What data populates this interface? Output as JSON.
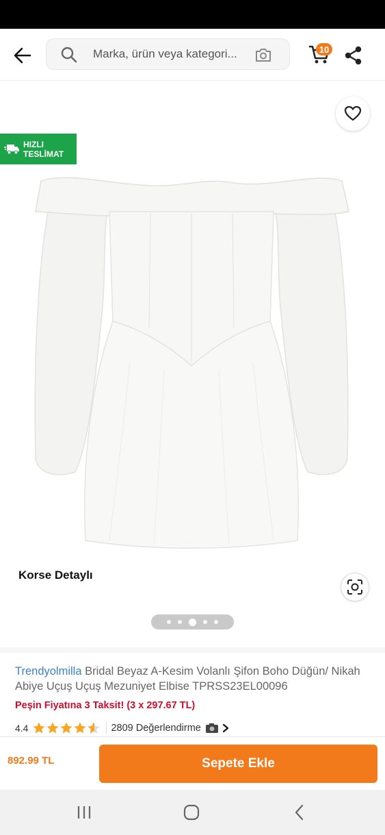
{
  "search": {
    "placeholder": "Marka, ürün veya kategori..."
  },
  "cart": {
    "badge_count": "10"
  },
  "badges": {
    "fast_delivery": "HIZLI TESLİMAT",
    "fast_delivery_line1": "HIZLI",
    "fast_delivery_line2": "TESLİMAT"
  },
  "product": {
    "caption": "Korse Detaylı",
    "brand": "Trendyolmilla",
    "name": " Bridal Beyaz A-Kesim Volanlı Şifon Boho Düğün/ Nikah Abiye Uçuş Uçuş Mezuniyet Elbise TPRSS23EL00096",
    "installment": "Peşin Fiyatına 3 Taksit! (3 x 297.67 TL)",
    "rating": "4.4",
    "rating_value": 4.4,
    "reviews": "2809 Değerlendirme",
    "image_index": 3,
    "image_count": 5
  },
  "purchase": {
    "price": "892.99 TL",
    "add_to_cart": "Sepete Ekle"
  },
  "colors": {
    "accent": "#f27a1a",
    "brand_link": "#3b82c4",
    "badge_green": "#1da34a",
    "installment_red": "#c8102e",
    "star": "#f6a623"
  },
  "icons": [
    "back-arrow-icon",
    "search-icon",
    "camera-icon",
    "cart-icon",
    "share-icon",
    "heart-icon",
    "truck-icon",
    "visual-search-icon",
    "star-icon",
    "camera-emoji-icon",
    "chevron-right-icon",
    "recents-icon",
    "home-icon",
    "back-icon"
  ]
}
